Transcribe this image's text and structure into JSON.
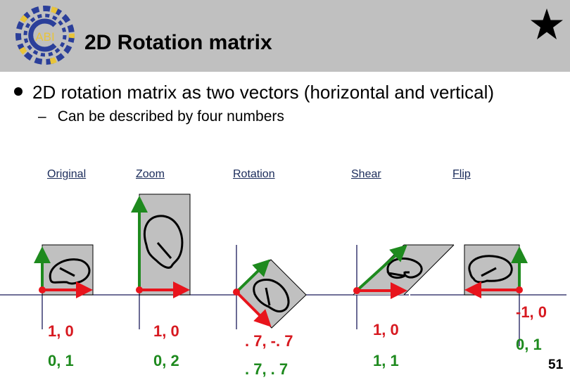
{
  "header": {
    "logo_text": "ABI",
    "title": "2D Rotation matrix",
    "star_icon": "star-icon"
  },
  "bullets": {
    "level1": "2D rotation matrix as two vectors (horizontal and vertical)",
    "level2_dash": "–",
    "level2": "Can be described by four numbers"
  },
  "colors": {
    "header_bg": "#c0c0c0",
    "horizontal_vector": "#d71920",
    "vertical_vector": "#1e8a1e",
    "label_color": "#1a2b5a"
  },
  "transforms": [
    {
      "label": "Original",
      "horizontal": "1, 0",
      "vertical": "0, 1"
    },
    {
      "label": "Zoom",
      "horizontal": "1, 0",
      "vertical": "0, 2"
    },
    {
      "label": "Rotation",
      "horizontal": ". 7, -. 7",
      "vertical": ". 7, . 7"
    },
    {
      "label": "Shear",
      "horizontal": "1, 0",
      "vertical": "1, 1"
    },
    {
      "label": "Flip",
      "horizontal": "-1, 0",
      "vertical": "0, 1"
    }
  ],
  "footer": {
    "page_number": "51"
  }
}
